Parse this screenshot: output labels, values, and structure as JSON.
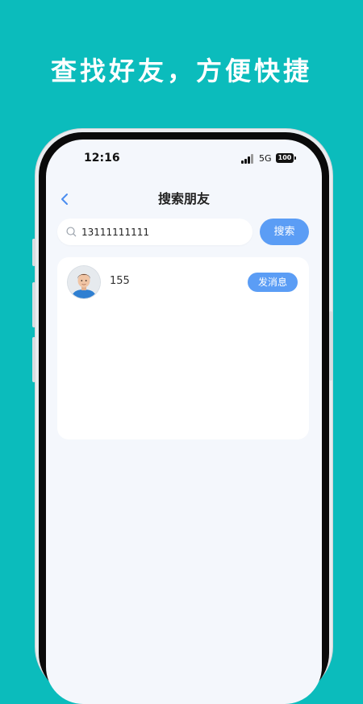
{
  "promo": {
    "headline": "查找好友，方便快捷"
  },
  "status_bar": {
    "time": "12:16",
    "network": "5G",
    "battery": "100"
  },
  "nav": {
    "back_icon": "chevron-left-icon",
    "title": "搜索朋友"
  },
  "search": {
    "icon": "search-icon",
    "value": "13111111111",
    "button_label": "搜索"
  },
  "results": [
    {
      "name": "155",
      "action_label": "发消息"
    }
  ],
  "colors": {
    "background": "#0bbcbc",
    "accent": "#5b9df5",
    "screen": "#f4f7fc"
  }
}
